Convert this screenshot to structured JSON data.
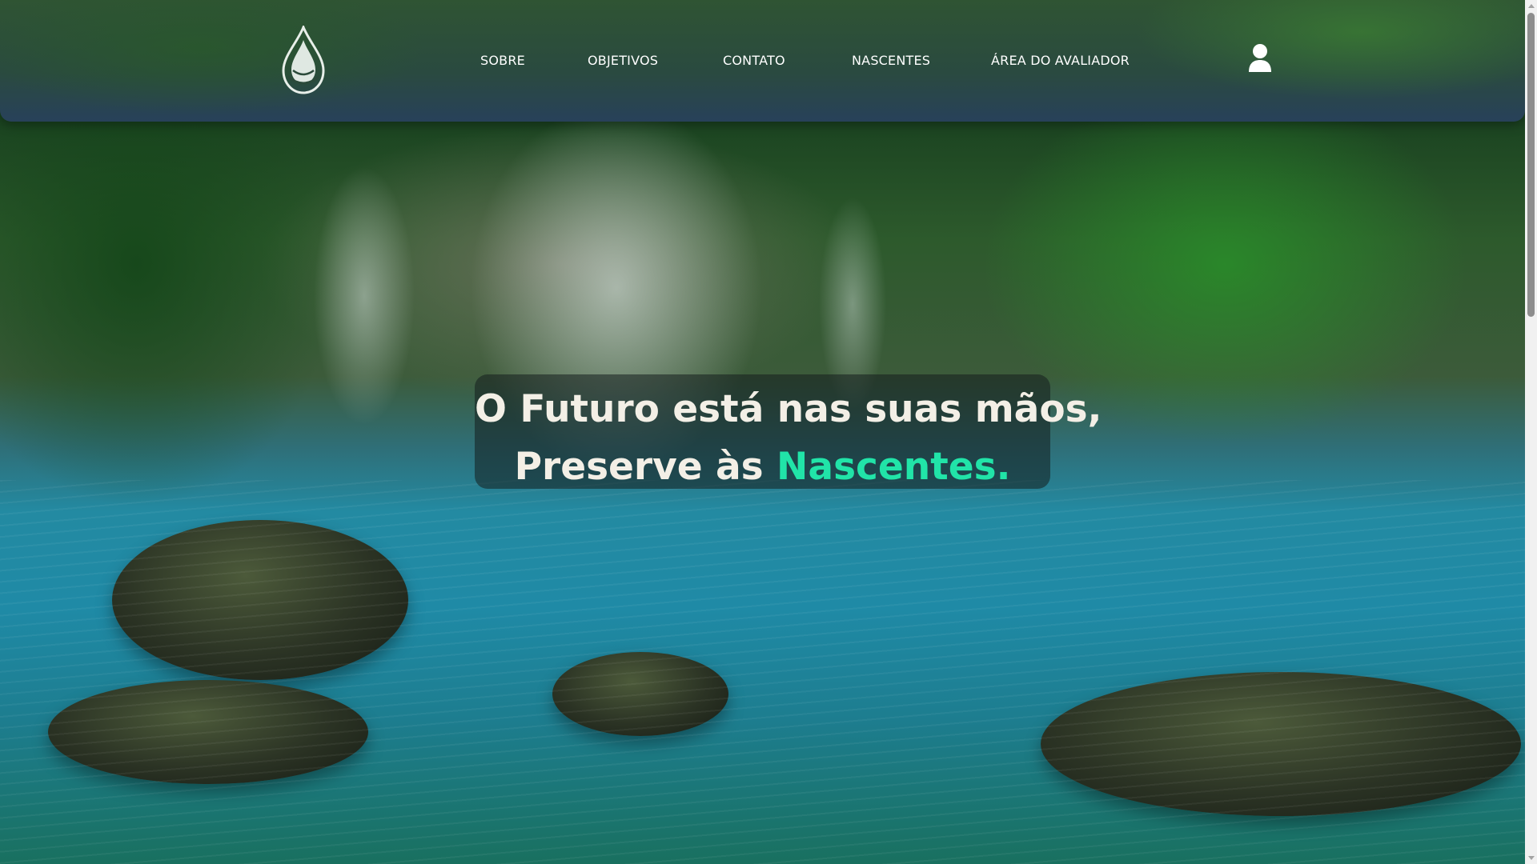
{
  "header": {
    "logo_icon": "water-drop-logo-icon",
    "nav": [
      {
        "label": "SOBRE"
      },
      {
        "label": "OBJETIVOS"
      },
      {
        "label": "CONTATO"
      },
      {
        "label": "NASCENTES"
      },
      {
        "label": "ÁREA DO AVALIADOR"
      }
    ],
    "user_icon": "user-icon"
  },
  "hero": {
    "line1": "O Futuro está nas suas mãos,",
    "line2_prefix": "Preserve às ",
    "line2_accent": "Nascentes."
  },
  "colors": {
    "accent": "#21e4a8",
    "headline_text": "#f3efe6",
    "nav_text": "#ffffff"
  },
  "background": {
    "scene": "waterfall-lagoon-forest-image"
  }
}
